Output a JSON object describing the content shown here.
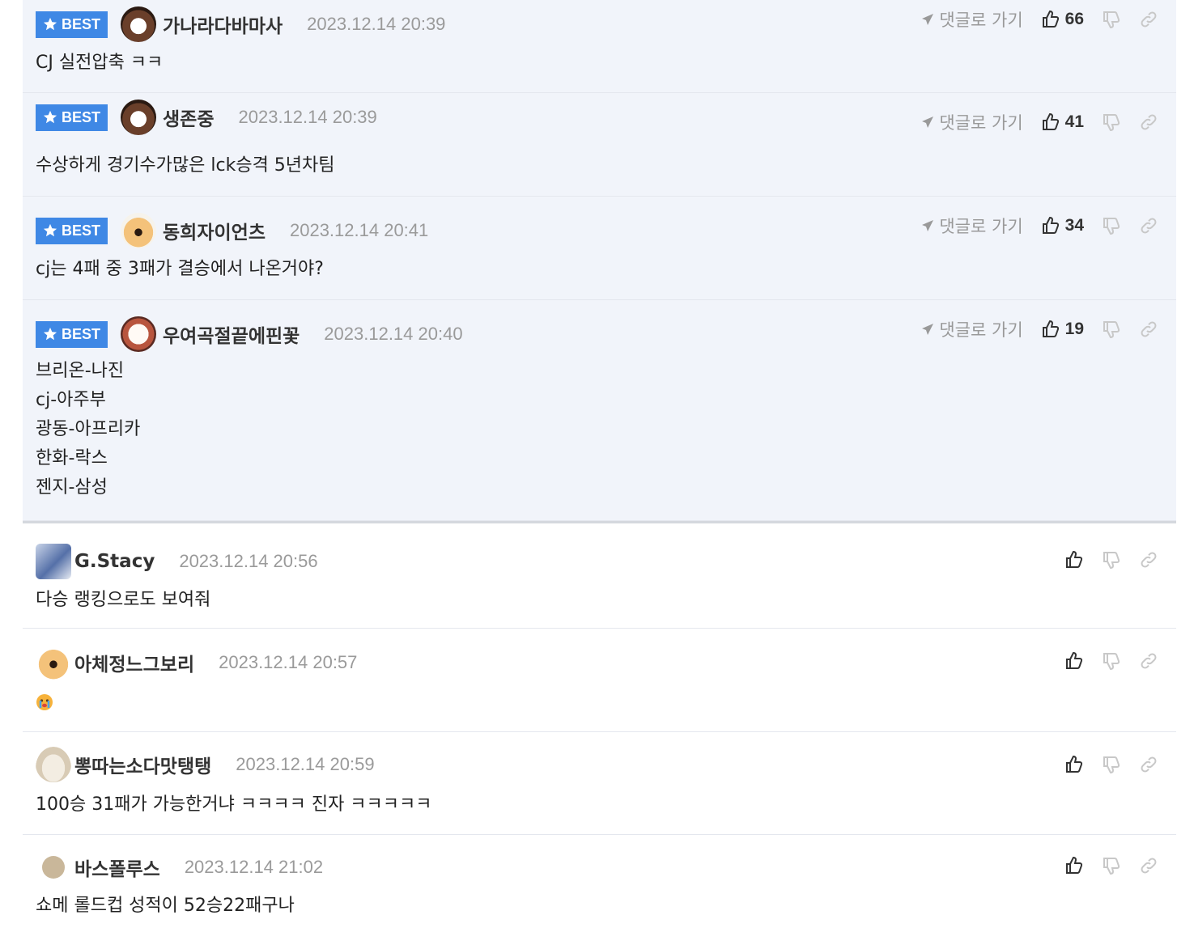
{
  "best_comments": [
    {
      "badge": "BEST",
      "nick": "가나라다바마사",
      "date": "2023.12.14 20:39",
      "goto": "댓글로 가기",
      "likes": "66",
      "lines": [
        "CJ 실전압축 ㅋㅋ"
      ]
    },
    {
      "badge": "BEST",
      "nick": "생존중",
      "date": "2023.12.14 20:39",
      "goto": "댓글로 가기",
      "likes": "41",
      "lines": [
        "수상하게 경기수가많은 lck승격 5년차팀"
      ]
    },
    {
      "badge": "BEST",
      "nick": "동희자이언츠",
      "date": "2023.12.14 20:41",
      "goto": "댓글로 가기",
      "likes": "34",
      "lines": [
        "cj는 4패 중 3패가 결승에서 나온거야?"
      ]
    },
    {
      "badge": "BEST",
      "nick": "우여곡절끝에핀꽃",
      "date": "2023.12.14 20:40",
      "goto": "댓글로 가기",
      "likes": "19",
      "lines": [
        "브리온-나진",
        "cj-아주부",
        "광동-아프리카",
        "한화-락스",
        "젠지-삼성"
      ]
    }
  ],
  "comments": [
    {
      "nick": "G.Stacy",
      "date": "2023.12.14 20:56",
      "lines": [
        "다승 랭킹으로도 보여줘"
      ]
    },
    {
      "nick": "아체정느그보리",
      "date": "2023.12.14 20:57",
      "lines": [],
      "emoji": "crying-face-icon"
    },
    {
      "nick": "뽕따는소다맛탱탱",
      "date": "2023.12.14 20:59",
      "lines": [
        "100승 31패가 가능한거냐 ㅋㅋㅋㅋ 진자 ㅋㅋㅋㅋㅋ"
      ]
    },
    {
      "nick": "바스폴루스",
      "date": "2023.12.14 21:02",
      "lines": [
        "쇼메 롤드컵 성적이 52승22패구나"
      ]
    }
  ],
  "colors": {
    "accent": "#3f88e5",
    "best_bg": "#f1f4fa",
    "date": "#9a9a9a"
  }
}
